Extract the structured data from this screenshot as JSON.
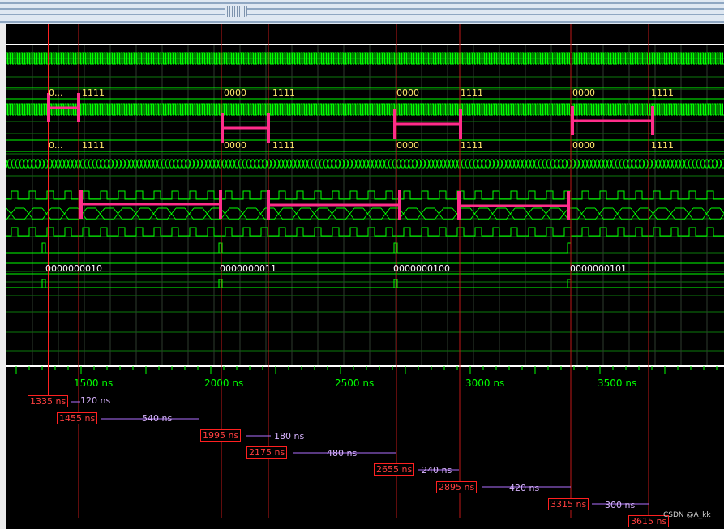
{
  "window": {
    "title": ""
  },
  "bus_values": {
    "row_a": [
      "0...",
      "1111",
      "0000",
      "1111",
      "0000",
      "1111",
      "0000",
      "1111"
    ],
    "row_b": [
      "0...",
      "1111",
      "0000",
      "1111",
      "0000",
      "1111",
      "0000",
      "1111"
    ],
    "counter": [
      "0000000010",
      "0000000011",
      "0000000100",
      "0000000101"
    ]
  },
  "time_axis": {
    "unit": "ns",
    "ticks": [
      "1500 ns",
      "2000 ns",
      "2500 ns",
      "3000 ns",
      "3500 ns"
    ]
  },
  "cursors": [
    {
      "label": "1335 ns",
      "delta": "120 ns"
    },
    {
      "label": "1455 ns",
      "delta": "540 ns"
    },
    {
      "label": "1995 ns",
      "delta": "180 ns"
    },
    {
      "label": "2175 ns",
      "delta": "480 ns"
    },
    {
      "label": "2655 ns",
      "delta": "240 ns"
    },
    {
      "label": "2895 ns",
      "delta": "420 ns"
    },
    {
      "label": "3315 ns",
      "delta": "300 ns"
    },
    {
      "label": "3615 ns",
      "delta": ""
    }
  ],
  "colors": {
    "waveform": "#00ff00",
    "cursor": "#ff2020",
    "delta": "#b070ff",
    "annotation": "#ff2d8a",
    "background": "#000000"
  },
  "watermark": "CSDN @A_kk"
}
